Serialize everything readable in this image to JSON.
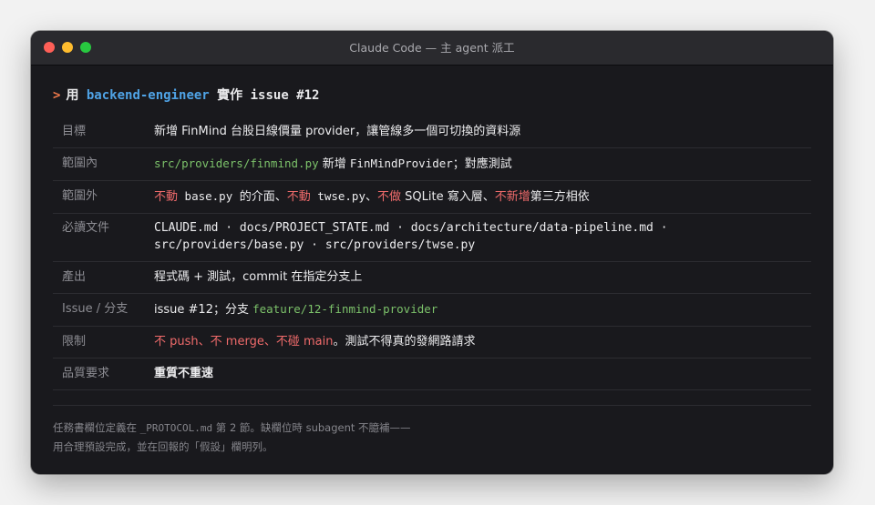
{
  "window": {
    "title": "Claude Code — 主 agent 派工"
  },
  "prompt": {
    "arrow": ">",
    "verb": "用",
    "agent": "backend-engineer",
    "action": "實作 issue #12"
  },
  "rows": {
    "goal": {
      "label": "目標",
      "text": "新增 FinMind 台股日線價量 provider，讓管線多一個可切換的資料源"
    },
    "in_scope": {
      "label": "範圍內",
      "path": "src/providers/finmind.py",
      "text_a": " 新增 ",
      "class_name": "FinMindProvider",
      "text_b": "；對應測試"
    },
    "out_scope": {
      "label": "範圍外",
      "no1": "不動",
      "file1": " base.py ",
      "mid1": "的介面、",
      "no2": "不動",
      "file2": " twse.py",
      "mid2": "、",
      "no3": "不做",
      "mid3": " SQLite 寫入層、",
      "no4": "不新增",
      "mid4": "第三方相依"
    },
    "required_docs": {
      "label": "必讀文件",
      "text": "CLAUDE.md · docs/PROJECT_STATE.md · docs/architecture/data-pipeline.md · src/providers/base.py · src/providers/twse.py"
    },
    "output": {
      "label": "產出",
      "text": "程式碼 + 測試，commit 在指定分支上"
    },
    "branch": {
      "label": "Issue / 分支",
      "text": "issue #12；分支 ",
      "branch_name": "feature/12-finmind-provider"
    },
    "limits": {
      "label": "限制",
      "l1": "不 push",
      "s1": "、",
      "l2": "不 merge",
      "s2": "、",
      "l3": "不碰 main",
      "tail": "。測試不得真的發網路請求"
    },
    "quality": {
      "label": "品質要求",
      "text": "重質不重速"
    }
  },
  "footnote": {
    "line1_a": "任務書欄位定義在 ",
    "line1_file": "_PROTOCOL.md",
    "line1_b": " 第 2 節。缺欄位時 subagent 不臆補——",
    "line2": "用合理預設完成，並在回報的「假設」欄明列。"
  },
  "colors": {
    "accent_orange": "#f07a4b",
    "agent_blue": "#4fa3e6",
    "path_green": "#7cc26a",
    "negation_red": "#f06b6b"
  }
}
